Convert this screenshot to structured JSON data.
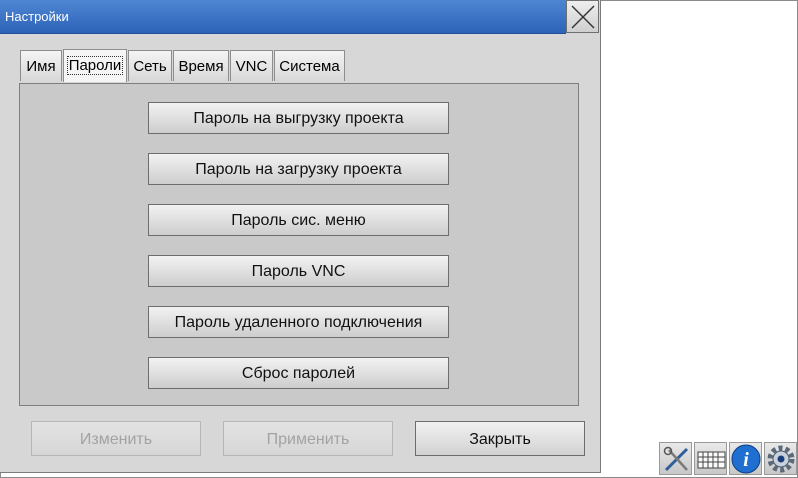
{
  "window": {
    "title": "Настройки"
  },
  "tabs": [
    {
      "label": "Имя"
    },
    {
      "label": "Пароли",
      "active": true
    },
    {
      "label": "Сеть"
    },
    {
      "label": "Время"
    },
    {
      "label": "VNC"
    },
    {
      "label": "Система"
    }
  ],
  "password_buttons": [
    {
      "label": "Пароль на выгрузку проекта"
    },
    {
      "label": "Пароль на загрузку проекта"
    },
    {
      "label": "Пароль сис. меню"
    },
    {
      "label": "Пароль VNC"
    },
    {
      "label": "Пароль удаленного подключения"
    },
    {
      "label": "Сброс паролей"
    }
  ],
  "footer": {
    "change_label": "Изменить",
    "apply_label": "Применить",
    "close_label": "Закрыть"
  },
  "tray": {
    "icons": [
      "tools-icon",
      "keyboard-icon",
      "info-icon",
      "gear-icon"
    ]
  },
  "colors": {
    "titlebar": "#3b73c6",
    "dialog_bg": "#d7d7d7",
    "panel_bg": "#c9c9c9",
    "info_blue": "#1f6fd1"
  }
}
